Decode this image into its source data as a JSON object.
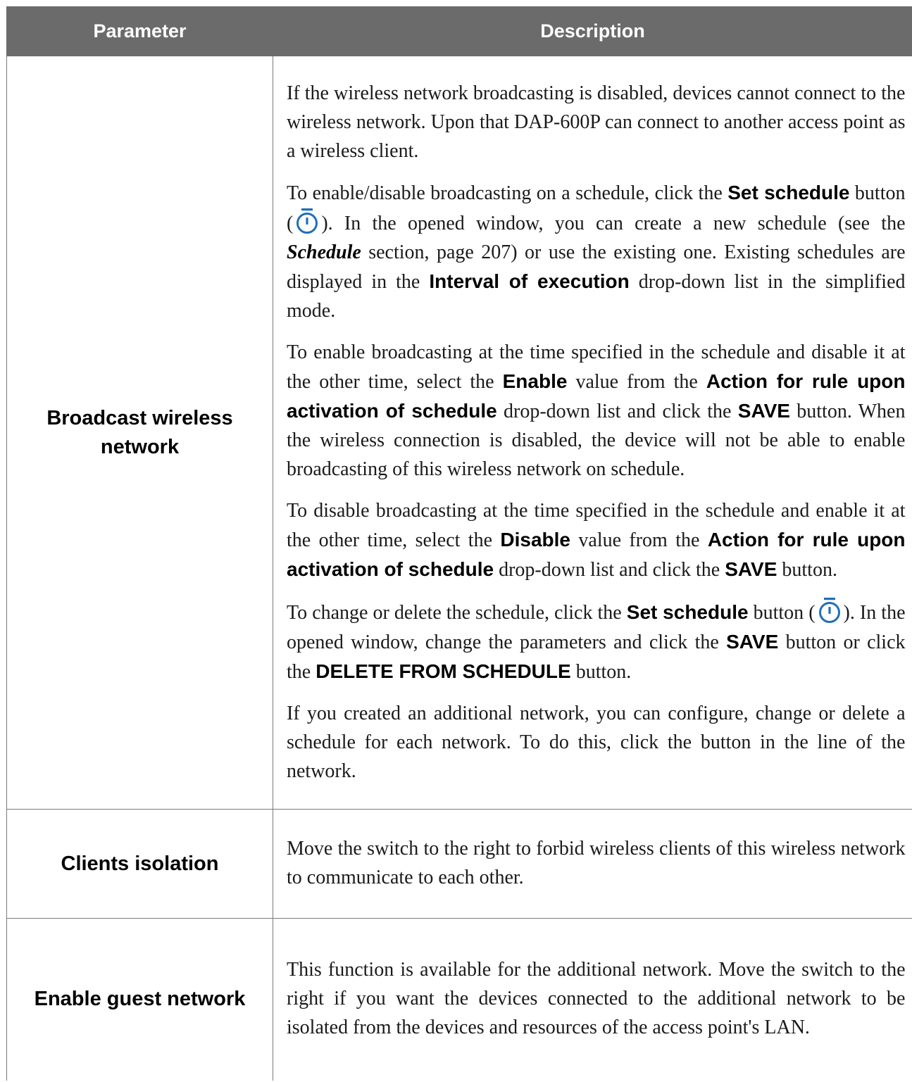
{
  "header": {
    "parameter": "Parameter",
    "description": "Description"
  },
  "rows": [
    {
      "parameter_lines": [
        "Broadcast wireless",
        "network"
      ],
      "p1": "If the wireless network broadcasting is disabled, devices cannot connect to the wireless network. Upon that DAP-600P can connect to another access point as a wireless client.",
      "p2": {
        "t1": "To enable/disable broadcasting on a schedule, click the ",
        "b1": "Set schedule",
        "t2": " button (",
        "t3": "). In the opened window, you can create a new schedule (see the ",
        "bi1": "Schedule",
        "t4": " section, page 207) or use the existing one. Existing schedules are displayed in the ",
        "b2": "Interval of execution",
        "t5": " drop-down list in the simplified mode."
      },
      "p3": {
        "t1": "To enable broadcasting at the time specified in the schedule and disable it at the other time, select the ",
        "b1": "Enable",
        "t2": " value from the ",
        "b2": "Action for rule upon activation of schedule",
        "t3": " drop-down list and click the ",
        "b3": "SAVE",
        "t4": " button. When the wireless connection is disabled, the device will not be able to enable broadcasting of this wireless network on schedule."
      },
      "p4": {
        "t1": "To disable broadcasting at the time specified in the schedule and enable it at the other time, select the ",
        "b1": "Disable",
        "t2": " value from the ",
        "b2": "Action for rule upon activation of schedule",
        "t3": " drop-down list and click the ",
        "b3": "SAVE",
        "t4": " button."
      },
      "p5": {
        "t1": "To change or delete the schedule, click the ",
        "b1": "Set schedule",
        "t2": " button (",
        "t3": "). In the opened window, change the parameters and click the ",
        "b2": "SAVE",
        "t4": " button or click the ",
        "b3": "DELETE FROM SCHEDULE",
        "t5": " button."
      },
      "p6": "If you created an additional network, you can configure, change or delete a schedule for each network. To do this, click the button in the line of the network."
    },
    {
      "parameter": "Clients isolation",
      "description": "Move the switch to the right to forbid wireless clients of this wireless network to communicate to each other."
    },
    {
      "parameter": "Enable guest network",
      "description": "This function is available for the additional network. Move the switch to the right if you want the devices connected to the additional network to be isolated from the devices and resources of the access point's LAN."
    }
  ],
  "icons": {
    "timer": "stopwatch-icon",
    "timer_color": "#1f6fb8"
  }
}
